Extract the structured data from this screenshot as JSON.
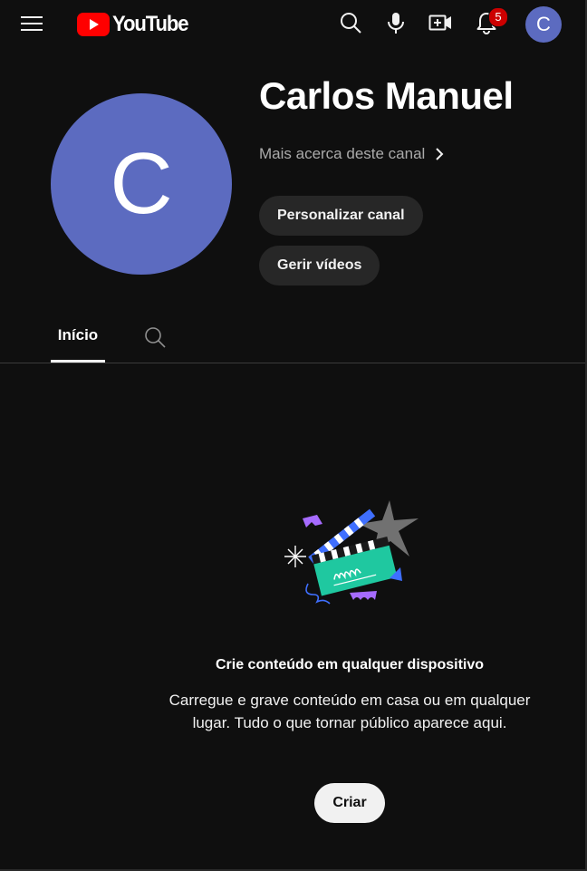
{
  "header": {
    "logo_text": "YouTube",
    "notification_count": "5",
    "avatar_letter": "C"
  },
  "channel": {
    "avatar_letter": "C",
    "name": "Carlos Manuel",
    "more_about": "Mais acerca deste canal",
    "customize_label": "Personalizar canal",
    "manage_label": "Gerir vídeos"
  },
  "tabs": [
    {
      "label": "Início",
      "selected": true
    }
  ],
  "empty_state": {
    "title": "Crie conteúdo em qualquer dispositivo",
    "description": "Carregue e grave conteúdo em casa ou em qualquer lugar. Tudo o que tornar público aparece aqui.",
    "create_label": "Criar"
  },
  "colors": {
    "background": "#0f0f0f",
    "avatar": "#5c6bc0",
    "brand_red": "#ff0000",
    "badge": "#cc0000",
    "pill": "#272727"
  }
}
